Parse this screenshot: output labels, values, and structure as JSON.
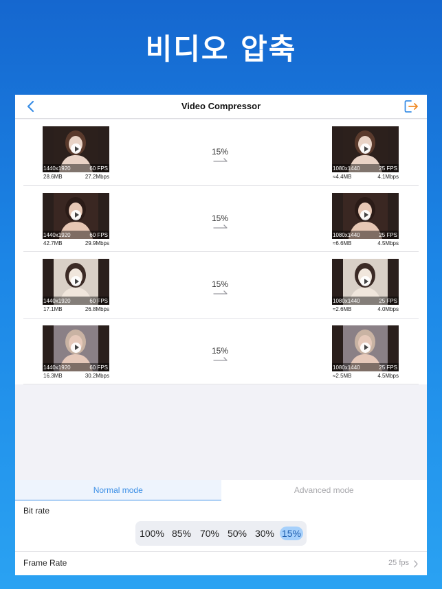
{
  "hero": {
    "title": "비디오 압축"
  },
  "nav": {
    "title": "Video Compressor",
    "back_icon": "chevron-left-icon",
    "export_icon": "export-icon",
    "accent": "#3a8ee6",
    "export_color": "#f08a24"
  },
  "videos": [
    {
      "src_res": "1440x1920",
      "src_fps": "60 FPS",
      "src_size": "28.6MB",
      "src_bitrate": "27.2Mbps",
      "pct": "15%",
      "dst_res": "1080x1440",
      "dst_fps": "25 FPS",
      "dst_size": "≈4.4MB",
      "dst_bitrate": "4.1Mbps"
    },
    {
      "src_res": "1440x1920",
      "src_fps": "60 FPS",
      "src_size": "42.7MB",
      "src_bitrate": "29.9Mbps",
      "pct": "15%",
      "dst_res": "1080x1440",
      "dst_fps": "25 FPS",
      "dst_size": "≈6.6MB",
      "dst_bitrate": "4.5Mbps"
    },
    {
      "src_res": "1440x1920",
      "src_fps": "60 FPS",
      "src_size": "17.1MB",
      "src_bitrate": "26.8Mbps",
      "pct": "15%",
      "dst_res": "1080x1440",
      "dst_fps": "25 FPS",
      "dst_size": "≈2.6MB",
      "dst_bitrate": "4.0Mbps"
    },
    {
      "src_res": "1440x1920",
      "src_fps": "60 FPS",
      "src_size": "16.3MB",
      "src_bitrate": "30.2Mbps",
      "pct": "15%",
      "dst_res": "1080x1440",
      "dst_fps": "25 FPS",
      "dst_size": "≈2.5MB",
      "dst_bitrate": "4.5Mbps"
    }
  ],
  "tabs": {
    "normal": "Normal mode",
    "advanced": "Advanced mode",
    "active": "normal"
  },
  "bitrate": {
    "label": "Bit rate",
    "options": [
      "100%",
      "85%",
      "70%",
      "50%",
      "30%",
      "15%"
    ],
    "selected": "15%"
  },
  "frame_rate": {
    "label": "Frame Rate",
    "value": "25 fps"
  }
}
